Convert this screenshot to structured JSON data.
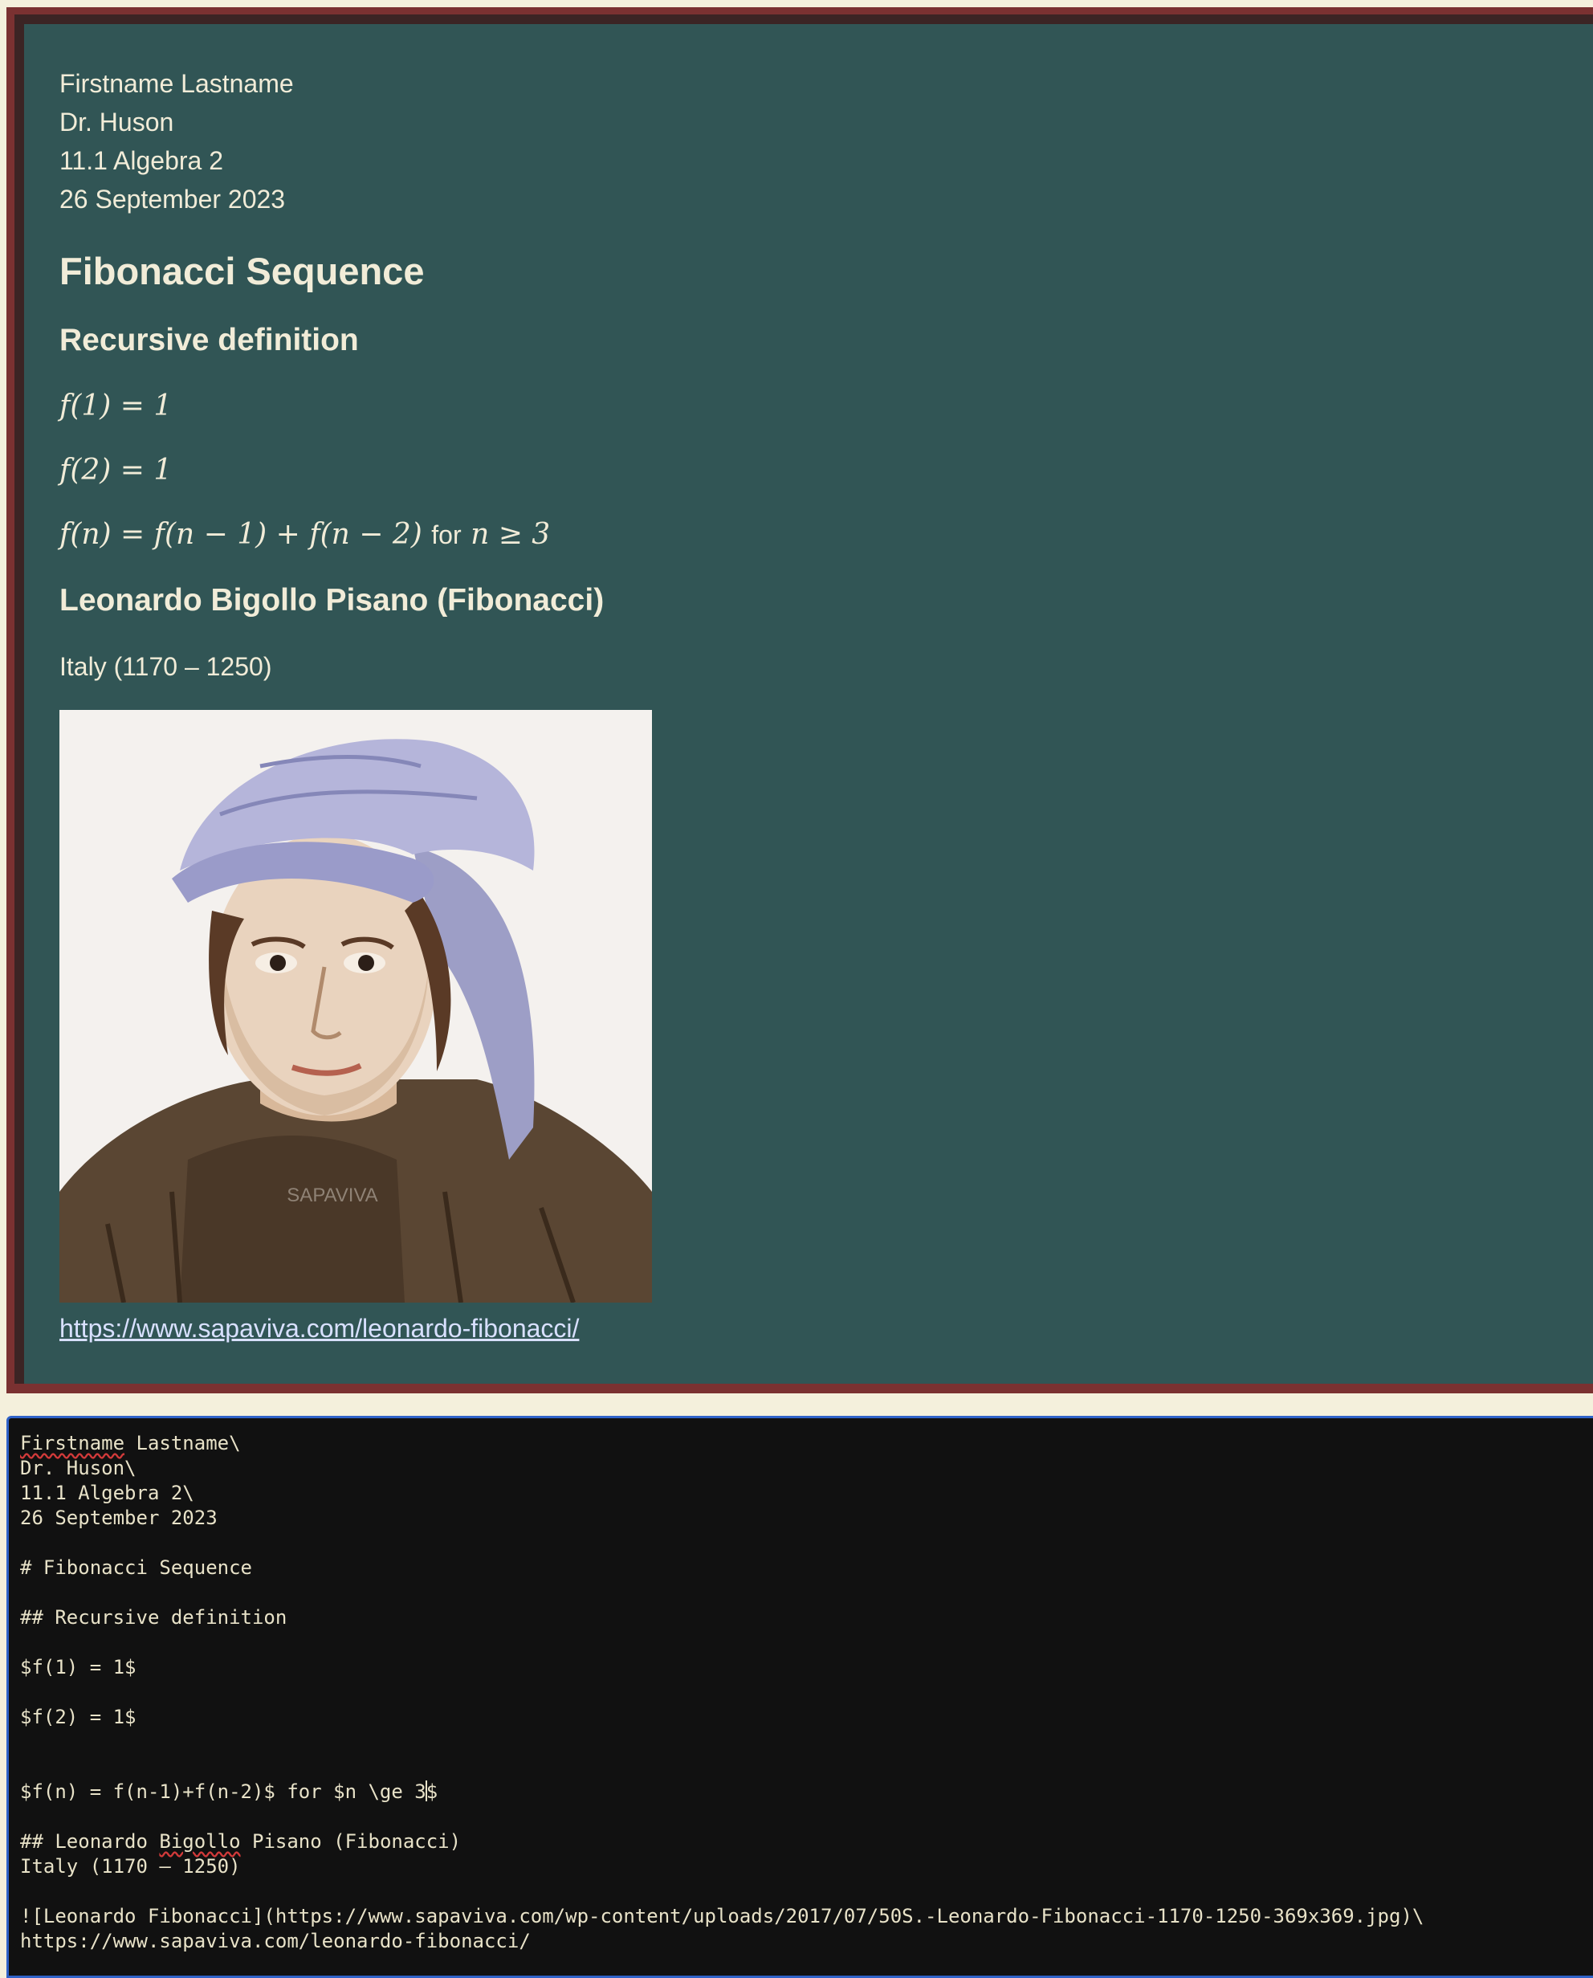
{
  "preview": {
    "header_lines": [
      "Firstname Lastname",
      "Dr. Huson",
      "11.1 Algebra 2",
      "26 September 2023"
    ],
    "title": "Fibonacci Sequence",
    "section_recursive": "Recursive definition",
    "equations": {
      "eq1": "f(1) = 1",
      "eq2": "f(2) = 1",
      "eq3_lhs": "f(n) = f(n − 1) + f(n − 2)",
      "eq3_for": "for",
      "eq3_cond": "n ≥ 3"
    },
    "section_person": "Leonardo Bigollo Pisano (Fibonacci)",
    "origin": "Italy (1170 – 1250)",
    "image_alt": "Leonardo Fibonacci",
    "image_watermark": "SAPAVIVA",
    "link": "https://www.sapaviva.com/leonardo-fibonacci/"
  },
  "editor": {
    "lines": [
      "Firstname Lastname\\",
      "Dr. Huson\\",
      "11.1 Algebra 2\\",
      "26 September 2023",
      "",
      "# Fibonacci Sequence",
      "",
      "## Recursive definition",
      "",
      "$f(1) = 1$",
      "",
      "$f(2) = 1$",
      "",
      "",
      "$f(n) = f(n-1)+f(n-2)$ for $n \\ge 3$",
      "",
      "## Leonardo Bigollo Pisano (Fibonacci)",
      "Italy (1170 – 1250)",
      "",
      "![Leonardo Fibonacci](https://www.sapaviva.com/wp-content/uploads/2017/07/50S.-Leonardo-Fibonacci-1170-1250-369x369.jpg)\\",
      "https://www.sapaviva.com/leonardo-fibonacci/"
    ],
    "line0_word": "Firstname",
    "line0_rest": " Lastname\\",
    "line14_before_caret": "$f(n) = f(n-1)+f(n-2)$ for $n \\ge 3",
    "line14_after_caret": "$",
    "line16_prefix": "## Leonardo ",
    "line16_word": "Bigollo",
    "line16_rest": " Pisano (Fibonacci)"
  },
  "colors": {
    "preview_bg": "#315555",
    "frame": "#7a3131",
    "editor_bg": "#111111",
    "editor_focus_border": "#2f62c8",
    "text_light": "#f1ecd8",
    "link": "#d8e0ff"
  }
}
